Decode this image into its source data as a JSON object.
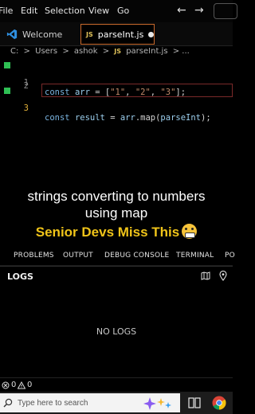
{
  "menubar": {
    "items": [
      "File",
      "Edit",
      "Selection",
      "View",
      "Go"
    ],
    "back_icon": "arrow-left-icon",
    "forward_icon": "arrow-right-icon"
  },
  "tabs": [
    {
      "label": "Welcome",
      "icon": "vscode-logo-icon"
    },
    {
      "label": "parseInt.js",
      "icon": "js-file-icon",
      "badge": "JS",
      "modified": true
    }
  ],
  "breadcrumb": {
    "parts": [
      "C:",
      ">",
      "Users",
      ">",
      "ashok",
      ">"
    ],
    "file_badge": "JS",
    "file": "parseInt.js",
    "tail": "> ..."
  },
  "editor": {
    "lines": [
      {
        "number": "1",
        "tokens": [
          {
            "t": "const ",
            "c": "kw"
          },
          {
            "t": "arr",
            "c": "ident"
          },
          {
            "t": " = [",
            "c": "plain"
          },
          {
            "t": "\"1\"",
            "c": "str"
          },
          {
            "t": ", ",
            "c": "plain"
          },
          {
            "t": "\"2\"",
            "c": "str"
          },
          {
            "t": ", ",
            "c": "plain"
          },
          {
            "t": "\"3\"",
            "c": "str"
          },
          {
            "t": "];",
            "c": "plain"
          }
        ]
      },
      {
        "number": "2",
        "tokens": []
      },
      {
        "number": "3",
        "tokens": [
          {
            "t": "const ",
            "c": "kw"
          },
          {
            "t": "result",
            "c": "ident"
          },
          {
            "t": " = ",
            "c": "plain"
          },
          {
            "t": "arr",
            "c": "ident"
          },
          {
            "t": ".map(",
            "c": "plain"
          },
          {
            "t": "parseInt",
            "c": "ident"
          },
          {
            "t": ");",
            "c": "plain"
          }
        ]
      }
    ],
    "active_line": "3"
  },
  "caption": {
    "line1": "strings converting to numbers",
    "line2": "using map",
    "highlight": "Senior Devs Miss This",
    "highlight_color": "#f0c419",
    "emoji": "grimacing-face-icon"
  },
  "panel": {
    "tabs": [
      "PROBLEMS",
      "OUTPUT",
      "DEBUG CONSOLE",
      "TERMINAL",
      "PO"
    ],
    "title": "LOGS",
    "empty_text": "NO LOGS"
  },
  "statusbar": {
    "errors": "0",
    "warnings": "0"
  },
  "taskbar": {
    "search_placeholder": "Type here to search"
  },
  "colors": {
    "accent_tab_border": "#c8692b",
    "gutter_added": "#2fbf54",
    "line_number_active": "#e6b43a"
  }
}
